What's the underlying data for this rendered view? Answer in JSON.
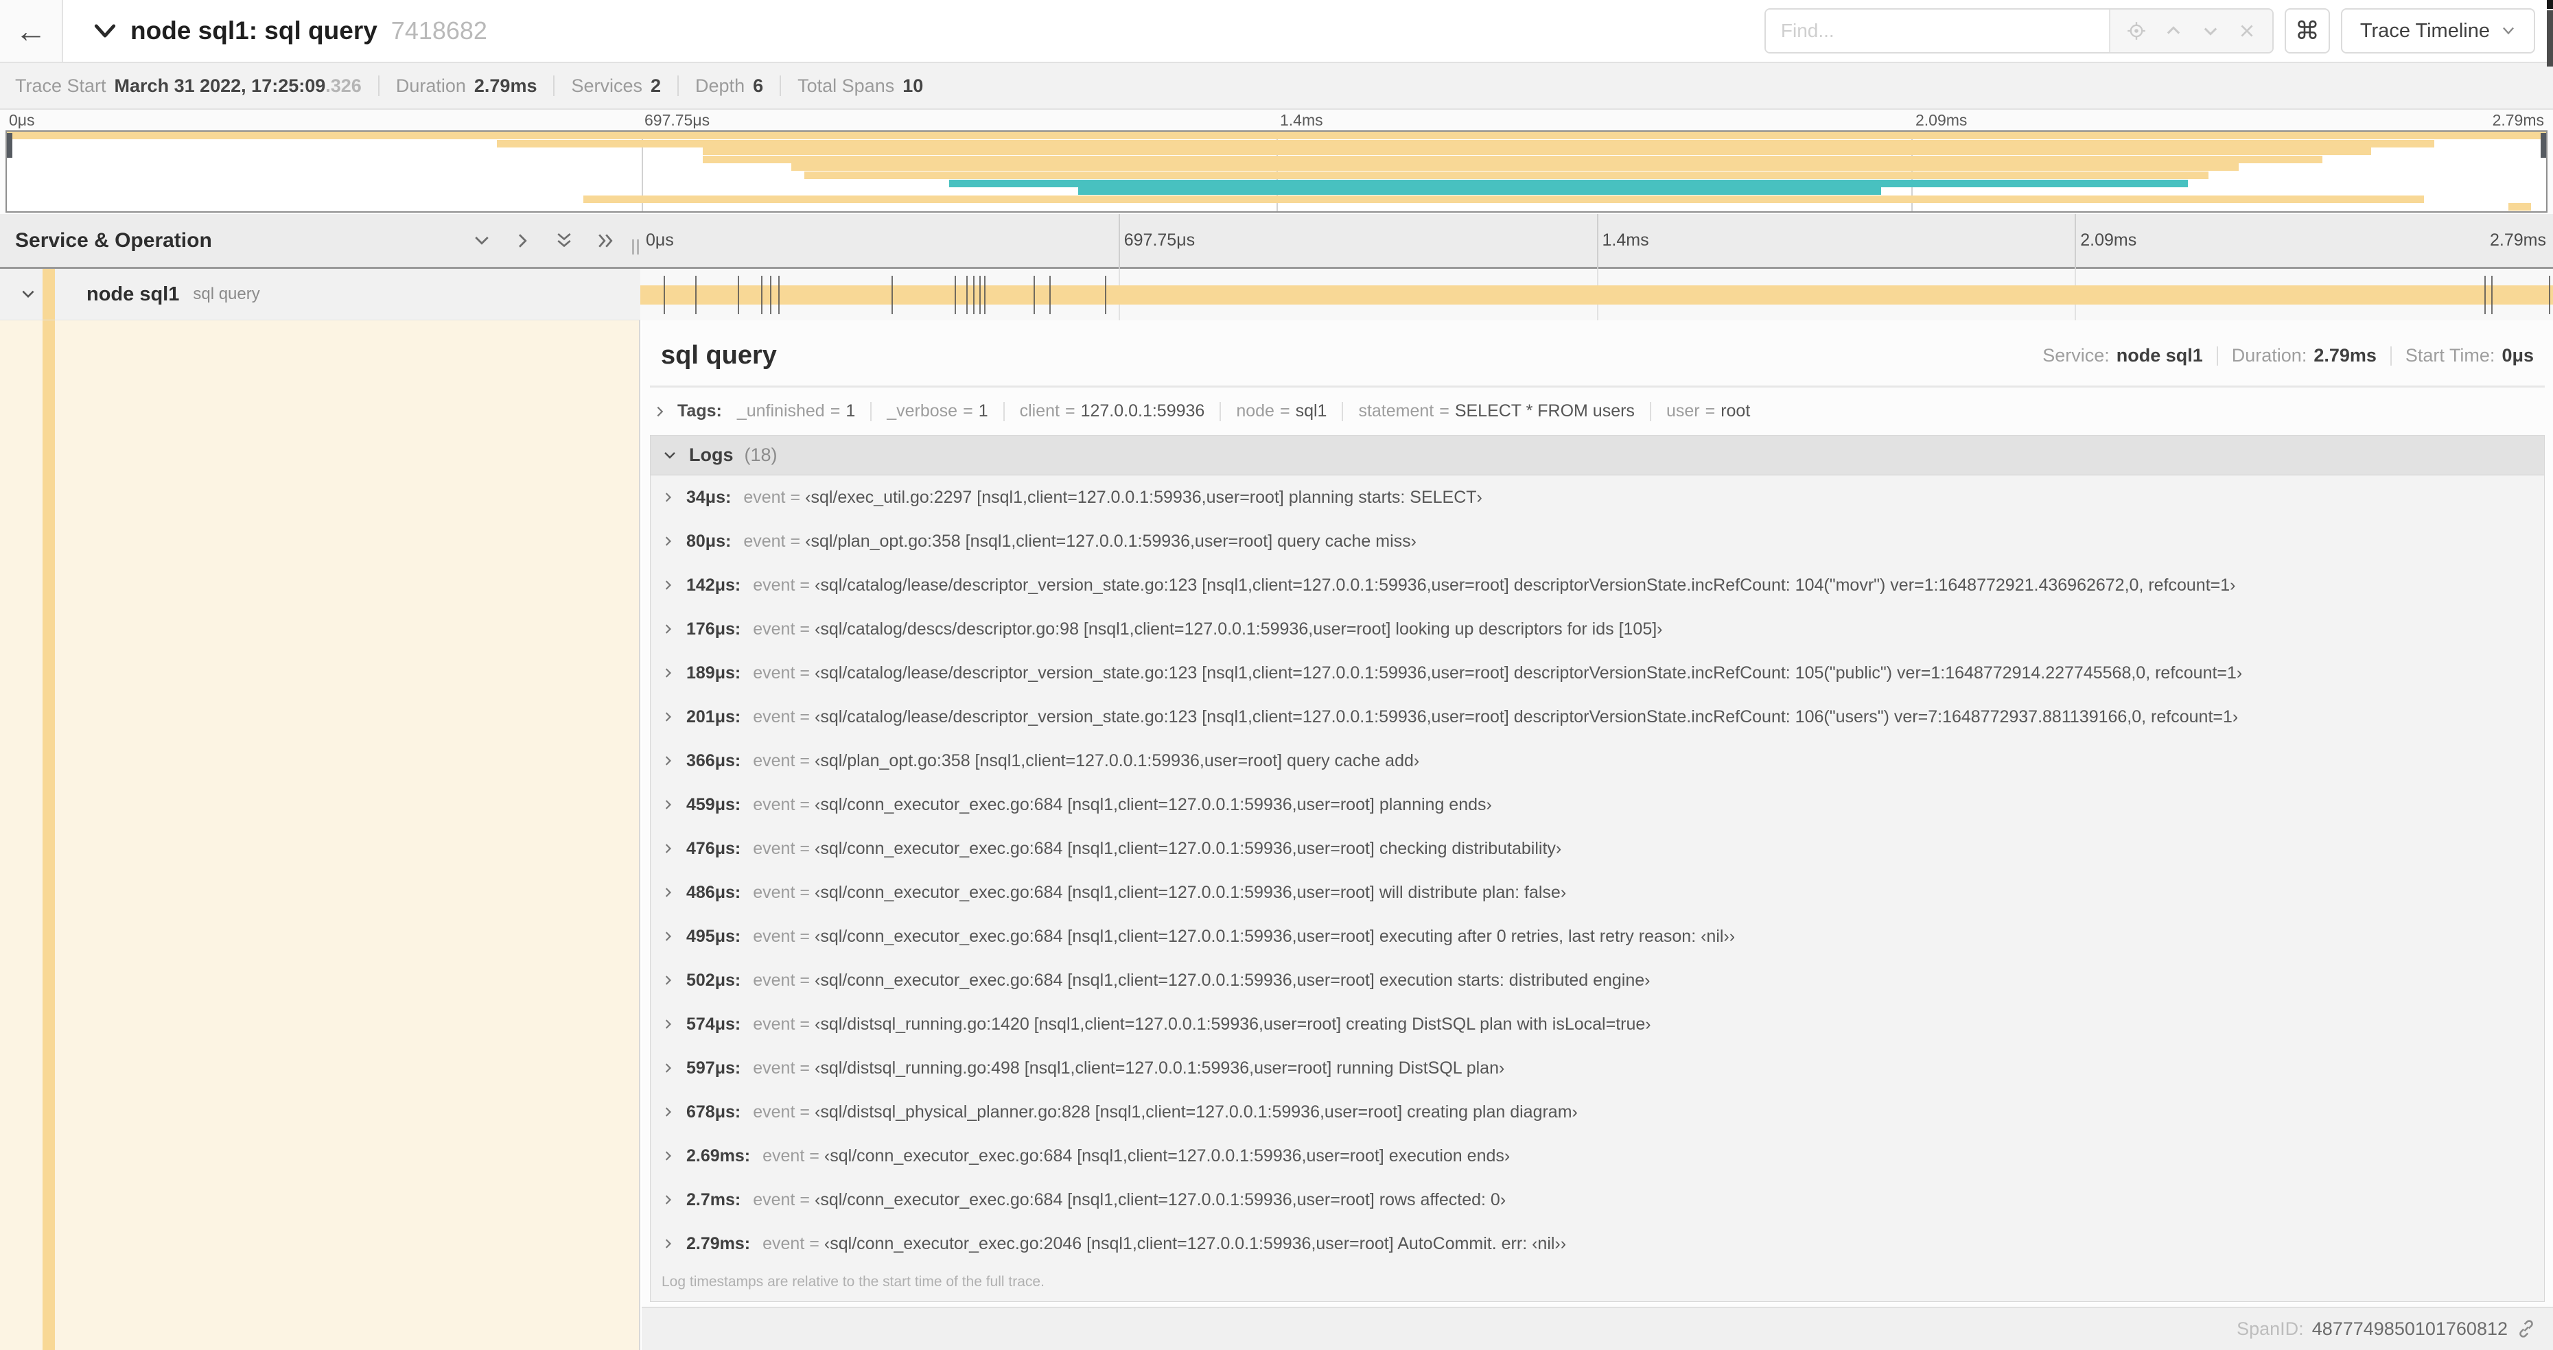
{
  "colors": {
    "tan": "#f8d896",
    "teal": "#48c1c0",
    "selected_bg": "#fcf4e3"
  },
  "icons": {
    "back-arrow": "←",
    "command-key": "⌘"
  },
  "topbar": {
    "back": "←",
    "title": "node sql1: sql query",
    "trace_id": "7418682",
    "find_placeholder": "Find...",
    "shortcut_key": "⌘",
    "view_selector": "Trace Timeline"
  },
  "summary": {
    "items": [
      {
        "label": "Trace Start",
        "value": "March 31 2022, 17:25:09",
        "suffix": ".326"
      },
      {
        "label": "Duration",
        "value": "2.79ms",
        "suffix": ""
      },
      {
        "label": "Services",
        "value": "2",
        "suffix": ""
      },
      {
        "label": "Depth",
        "value": "6",
        "suffix": ""
      },
      {
        "label": "Total Spans",
        "value": "10",
        "suffix": ""
      }
    ]
  },
  "minimap": {
    "ticks": [
      {
        "label": "0μs",
        "pos": 0
      },
      {
        "label": "697.75μs",
        "pos": 0.25
      },
      {
        "label": "1.4ms",
        "pos": 0.5
      },
      {
        "label": "2.09ms",
        "pos": 0.75
      },
      {
        "label": "2.79ms",
        "pos": 1
      }
    ],
    "spans": [
      {
        "start": 0.0,
        "end": 1.0,
        "color": "tan"
      },
      {
        "start": 0.193,
        "end": 0.956,
        "color": "tan"
      },
      {
        "start": 0.274,
        "end": 0.931,
        "color": "tan"
      },
      {
        "start": 0.274,
        "end": 0.912,
        "color": "tan"
      },
      {
        "start": 0.309,
        "end": 0.879,
        "color": "tan"
      },
      {
        "start": 0.314,
        "end": 0.867,
        "color": "tan"
      },
      {
        "start": 0.371,
        "end": 0.859,
        "color": "teal"
      },
      {
        "start": 0.422,
        "end": 0.738,
        "color": "teal"
      },
      {
        "start": 0.227,
        "end": 0.952,
        "color": "tan"
      },
      {
        "start": 0.985,
        "end": 0.994,
        "color": "tan"
      }
    ]
  },
  "timeline": {
    "header": "Service & Operation",
    "ticks": [
      {
        "label": "0μs",
        "pos": 0
      },
      {
        "label": "697.75μs",
        "pos": 0.25
      },
      {
        "label": "1.4ms",
        "pos": 0.5
      },
      {
        "label": "2.09ms",
        "pos": 0.75
      },
      {
        "label": "2.79ms",
        "pos": 1
      }
    ],
    "row": {
      "service": "node sql1",
      "operation": "sql query",
      "bar_start": 0,
      "bar_end": 1,
      "bar_color": "tan",
      "log_markers": [
        0.0122,
        0.0287,
        0.0509,
        0.0631,
        0.0677,
        0.072,
        0.1312,
        0.1645,
        0.1706,
        0.1742,
        0.1774,
        0.1799,
        0.2057,
        0.214,
        0.243,
        0.9642,
        0.9677,
        0.998
      ]
    }
  },
  "detail": {
    "title": "sql query",
    "overview": [
      {
        "label": "Service:",
        "value": "node sql1"
      },
      {
        "label": "Duration:",
        "value": "2.79ms"
      },
      {
        "label": "Start Time:",
        "value": "0μs"
      }
    ],
    "tags": {
      "label": "Tags:",
      "eq": "=",
      "items": [
        {
          "key": "_unfinished",
          "value": "1"
        },
        {
          "key": "_verbose",
          "value": "1"
        },
        {
          "key": "client",
          "value": "127.0.0.1:59936"
        },
        {
          "key": "node",
          "value": "sql1"
        },
        {
          "key": "statement",
          "value": "SELECT * FROM users"
        },
        {
          "key": "user",
          "value": "root"
        }
      ]
    },
    "logs": {
      "title": "Logs",
      "count": "(18)",
      "event_key": "event",
      "eq": "=",
      "rows": [
        {
          "time": "34μs:",
          "message": "‹sql/exec_util.go:2297 [nsql1,client=127.0.0.1:59936,user=root] planning starts: SELECT›"
        },
        {
          "time": "80μs:",
          "message": "‹sql/plan_opt.go:358 [nsql1,client=127.0.0.1:59936,user=root] query cache miss›"
        },
        {
          "time": "142μs:",
          "message": "‹sql/catalog/lease/descriptor_version_state.go:123 [nsql1,client=127.0.0.1:59936,user=root] descriptorVersionState.incRefCount: 104(\"movr\") ver=1:1648772921.436962672,0, refcount=1›"
        },
        {
          "time": "176μs:",
          "message": "‹sql/catalog/descs/descriptor.go:98 [nsql1,client=127.0.0.1:59936,user=root] looking up descriptors for ids [105]›"
        },
        {
          "time": "189μs:",
          "message": "‹sql/catalog/lease/descriptor_version_state.go:123 [nsql1,client=127.0.0.1:59936,user=root] descriptorVersionState.incRefCount: 105(\"public\") ver=1:1648772914.227745568,0, refcount=1›"
        },
        {
          "time": "201μs:",
          "message": "‹sql/catalog/lease/descriptor_version_state.go:123 [nsql1,client=127.0.0.1:59936,user=root] descriptorVersionState.incRefCount: 106(\"users\") ver=7:1648772937.881139166,0, refcount=1›"
        },
        {
          "time": "366μs:",
          "message": "‹sql/plan_opt.go:358 [nsql1,client=127.0.0.1:59936,user=root] query cache add›"
        },
        {
          "time": "459μs:",
          "message": "‹sql/conn_executor_exec.go:684 [nsql1,client=127.0.0.1:59936,user=root] planning ends›"
        },
        {
          "time": "476μs:",
          "message": "‹sql/conn_executor_exec.go:684 [nsql1,client=127.0.0.1:59936,user=root] checking distributability›"
        },
        {
          "time": "486μs:",
          "message": "‹sql/conn_executor_exec.go:684 [nsql1,client=127.0.0.1:59936,user=root] will distribute plan: false›"
        },
        {
          "time": "495μs:",
          "message": "‹sql/conn_executor_exec.go:684 [nsql1,client=127.0.0.1:59936,user=root] executing after 0 retries, last retry reason: ‹nil››"
        },
        {
          "time": "502μs:",
          "message": "‹sql/conn_executor_exec.go:684 [nsql1,client=127.0.0.1:59936,user=root] execution starts: distributed engine›"
        },
        {
          "time": "574μs:",
          "message": "‹sql/distsql_running.go:1420 [nsql1,client=127.0.0.1:59936,user=root] creating DistSQL plan with isLocal=true›"
        },
        {
          "time": "597μs:",
          "message": "‹sql/distsql_running.go:498 [nsql1,client=127.0.0.1:59936,user=root] running DistSQL plan›"
        },
        {
          "time": "678μs:",
          "message": "‹sql/distsql_physical_planner.go:828 [nsql1,client=127.0.0.1:59936,user=root] creating plan diagram›"
        },
        {
          "time": "2.69ms:",
          "message": "‹sql/conn_executor_exec.go:684 [nsql1,client=127.0.0.1:59936,user=root] execution ends›"
        },
        {
          "time": "2.7ms:",
          "message": "‹sql/conn_executor_exec.go:684 [nsql1,client=127.0.0.1:59936,user=root] rows affected: 0›"
        },
        {
          "time": "2.79ms:",
          "message": "‹sql/conn_executor_exec.go:2046 [nsql1,client=127.0.0.1:59936,user=root] AutoCommit. err: ‹nil››"
        }
      ],
      "footnote": "Log timestamps are relative to the start time of the full trace."
    },
    "span_meta": {
      "label": "SpanID:",
      "value": "4877749850101760812"
    }
  }
}
